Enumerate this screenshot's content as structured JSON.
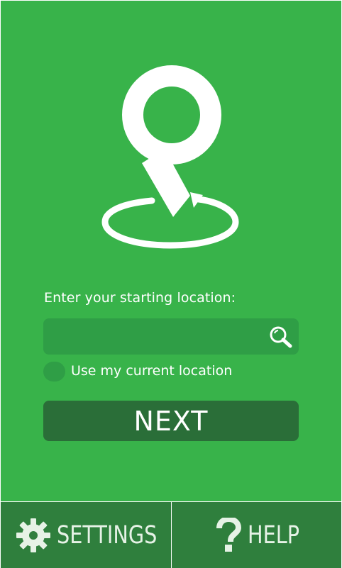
{
  "logo": {
    "icon": "location-pin-icon"
  },
  "location": {
    "label": "Enter your starting location:",
    "input_value": "",
    "placeholder": ""
  },
  "current_location": {
    "label": "Use my current location",
    "checked": false
  },
  "next_button": {
    "label": "NEXT"
  },
  "bottom_bar": {
    "settings_label": "SETTINGS",
    "settings_icon": "gear-icon",
    "help_label": "HELP",
    "help_icon": "question-icon"
  },
  "colors": {
    "background": "#38b34a",
    "field": "#2f9e46",
    "button": "#2a6e38",
    "bottom_bar": "#2f7f3d",
    "text": "#ffffff"
  }
}
